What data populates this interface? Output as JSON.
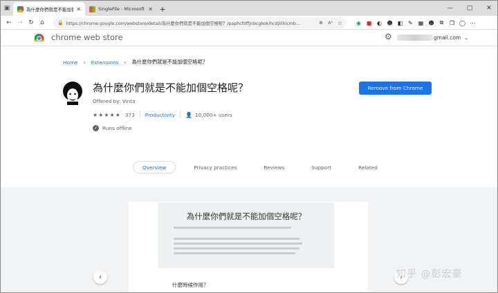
{
  "browser": {
    "tabs": [
      {
        "title": "為什麼你們就是不能加個空格呢 - C",
        "active": true
      },
      {
        "title": "SingleFile - Microsoft Edge Add",
        "active": false
      }
    ],
    "url": "https://chrome.google.com/webstore/detail/為什麼你們就是不能加個空格呢？/paphcfdffjnbcgkokihcdjliihicmb..."
  },
  "store": {
    "name": "chrome web store",
    "account_suffix": "gmail.com"
  },
  "breadcrumb": {
    "home": "Home",
    "extensions": "Extensions",
    "current": "為什麼你們就是不能加個空格呢？"
  },
  "extension": {
    "title": "為什麼你們就是不能加個空格呢？",
    "offered_by": "Offered by: Vinta",
    "rating_stars": 4.5,
    "rating_count": "373",
    "category": "Productivity",
    "users": "10,000+ users",
    "offline": "Runs offline",
    "action_label": "Remove from Chrome"
  },
  "page_tabs": [
    "Overview",
    "Privacy practices",
    "Reviews",
    "Support",
    "Related"
  ],
  "screenshot": {
    "title": "為什麼你們就是不能加個空格呢？",
    "below_heading": "什麼時候作用？",
    "watermark": "知乎 @彭宏豪"
  },
  "colors": {
    "accent": "#1a73e8"
  }
}
